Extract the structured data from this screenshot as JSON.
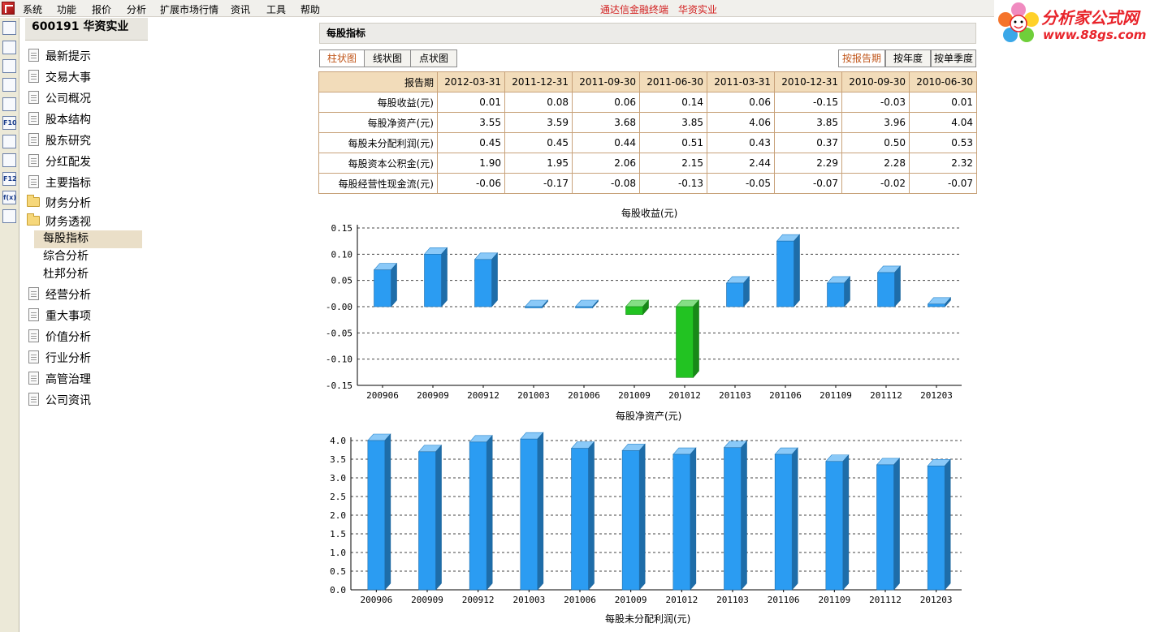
{
  "menu": {
    "items": [
      "系统",
      "功能",
      "报价",
      "分析",
      "扩展市场行情",
      "资讯",
      "工具",
      "帮助"
    ],
    "terminal_title": "通达信金融终端",
    "stock_title": "华资实业"
  },
  "watermark": {
    "title": "分析家公式网",
    "url": "www.88gs.com"
  },
  "toolbar": {
    "icons": [
      "info-icon",
      "list-icon",
      "line-chart-icon",
      "kline-icon",
      "news-icon",
      "f10-icon",
      "report-icon",
      "notice-icon",
      "f12-icon",
      "formula-icon",
      "search-icon"
    ],
    "labels": [
      "",
      "",
      "",
      "",
      "",
      "F10",
      "",
      "",
      "F12",
      "f(x)",
      ""
    ]
  },
  "sidebar": {
    "stock_header": "600191  华资实业",
    "items": [
      {
        "label": "最新提示",
        "type": "doc"
      },
      {
        "label": "交易大事",
        "type": "doc"
      },
      {
        "label": "公司概况",
        "type": "doc"
      },
      {
        "label": "股本结构",
        "type": "doc"
      },
      {
        "label": "股东研究",
        "type": "doc"
      },
      {
        "label": "分红配发",
        "type": "doc"
      },
      {
        "label": "主要指标",
        "type": "doc"
      },
      {
        "label": "财务分析",
        "type": "folder"
      },
      {
        "label": "财务透视",
        "type": "folder-open"
      }
    ],
    "sub_items": [
      "每股指标",
      "综合分析",
      "杜邦分析"
    ],
    "items_after": [
      {
        "label": "经营分析",
        "type": "doc"
      },
      {
        "label": "重大事项",
        "type": "doc"
      },
      {
        "label": "价值分析",
        "type": "doc"
      },
      {
        "label": "行业分析",
        "type": "doc"
      },
      {
        "label": "高管治理",
        "type": "doc"
      },
      {
        "label": "公司资讯",
        "type": "doc"
      }
    ]
  },
  "main": {
    "section_title": "每股指标",
    "chart_tabs": [
      "柱状图",
      "线状图",
      "点状图"
    ],
    "period_tabs": [
      "按报告期",
      "按年度",
      "按单季度"
    ],
    "table": {
      "header_label": "报告期",
      "periods": [
        "2012-03-31",
        "2011-12-31",
        "2011-09-30",
        "2011-06-30",
        "2011-03-31",
        "2010-12-31",
        "2010-09-30",
        "2010-06-30"
      ],
      "rows": [
        {
          "label": "每股收益(元)",
          "values": [
            "0.01",
            "0.08",
            "0.06",
            "0.14",
            "0.06",
            "-0.15",
            "-0.03",
            "0.01"
          ]
        },
        {
          "label": "每股净资产(元)",
          "values": [
            "3.55",
            "3.59",
            "3.68",
            "3.85",
            "4.06",
            "3.85",
            "3.96",
            "4.04"
          ]
        },
        {
          "label": "每股未分配利润(元)",
          "values": [
            "0.45",
            "0.45",
            "0.44",
            "0.51",
            "0.43",
            "0.37",
            "0.50",
            "0.53"
          ]
        },
        {
          "label": "每股资本公积金(元)",
          "values": [
            "1.90",
            "1.95",
            "2.06",
            "2.15",
            "2.44",
            "2.29",
            "2.28",
            "2.32"
          ]
        },
        {
          "label": "每股经营性现金流(元)",
          "values": [
            "-0.06",
            "-0.17",
            "-0.08",
            "-0.13",
            "-0.05",
            "-0.07",
            "-0.02",
            "-0.07"
          ]
        }
      ]
    },
    "third_chart_title": "每股未分配利润(元)"
  },
  "chart_data": [
    {
      "type": "bar",
      "title": "每股收益(元)",
      "categories": [
        "200906",
        "200909",
        "200912",
        "201003",
        "201006",
        "201009",
        "201012",
        "201103",
        "201106",
        "201109",
        "201112",
        "201203"
      ],
      "values": [
        0.07,
        0.1,
        0.09,
        0.0,
        0.0,
        -0.015,
        -0.135,
        0.045,
        0.125,
        0.045,
        0.065,
        0.005
      ],
      "ylim": [
        -0.15,
        0.15
      ],
      "yticks": [
        "0.15",
        "0.10",
        "0.05",
        "-0.00",
        "-0.05",
        "-0.10",
        "-0.15"
      ],
      "positive_color": "#2b9cf2",
      "negative_color": "#22c322"
    },
    {
      "type": "bar",
      "title": "每股净资产(元)",
      "categories": [
        "200906",
        "200909",
        "200912",
        "201003",
        "201006",
        "201009",
        "201012",
        "201103",
        "201106",
        "201109",
        "201112",
        "201203"
      ],
      "values": [
        4.0,
        3.7,
        3.96,
        4.04,
        3.79,
        3.73,
        3.63,
        3.81,
        3.63,
        3.44,
        3.35,
        3.32
      ],
      "ylim": [
        0.0,
        4.0
      ],
      "yticks": [
        "4.0",
        "3.5",
        "3.0",
        "2.5",
        "2.0",
        "1.5",
        "1.0",
        "0.5",
        "0.0"
      ],
      "positive_color": "#2b9cf2"
    }
  ]
}
